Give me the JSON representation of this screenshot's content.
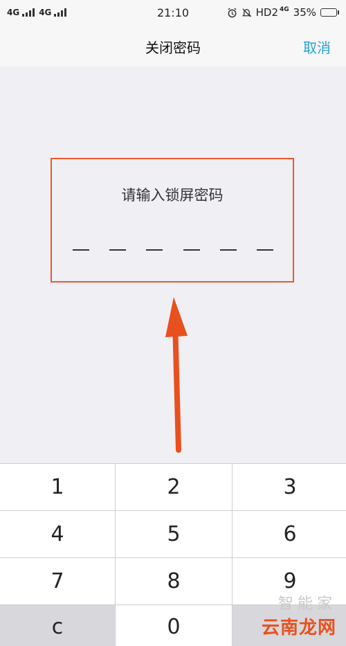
{
  "status_bar": {
    "signal_1": "4G",
    "signal_2": "4G",
    "time": "21:10",
    "hd_label": "HD2",
    "net_label": "4G",
    "battery_pct": "35%",
    "battery_level": 0.35,
    "icons": [
      "signal-icon",
      "alarm-icon",
      "mute-icon",
      "battery-icon"
    ]
  },
  "nav": {
    "title": "关闭密码",
    "cancel_label": "取消"
  },
  "prompt": {
    "text": "请输入锁屏密码",
    "slots": 6
  },
  "keypad": {
    "keys": [
      "1",
      "2",
      "3",
      "4",
      "5",
      "6",
      "7",
      "8",
      "9",
      "c",
      "0",
      ""
    ]
  },
  "watermark": {
    "top": "智能家",
    "bottom": "云南龙网"
  },
  "colors": {
    "accent": "#1fa3d8",
    "highlight": "#e8592a",
    "background": "#efeff4"
  }
}
